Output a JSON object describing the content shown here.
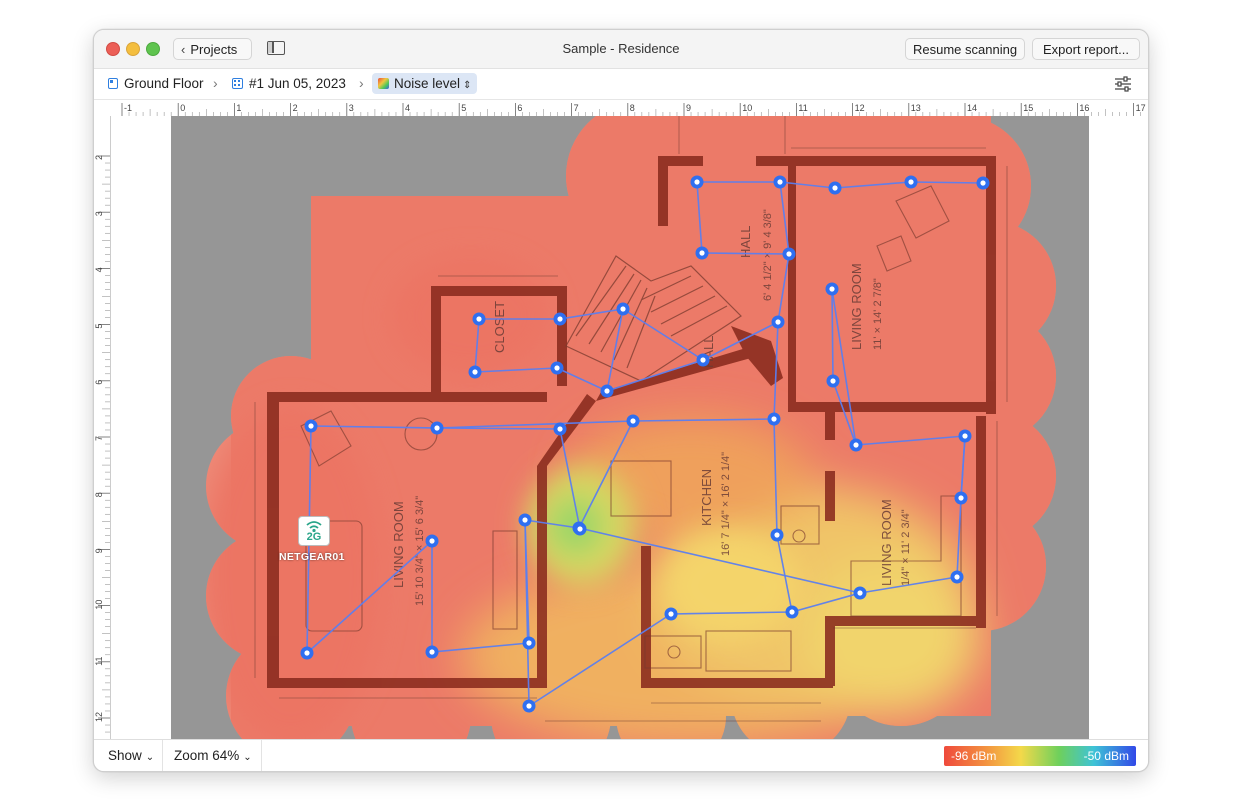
{
  "window": {
    "title": "Sample - Residence",
    "projects_label": "Projects",
    "resume_label": "Resume scanning",
    "export_label": "Export report..."
  },
  "breadcrumb": {
    "floor": "Ground Floor",
    "scan": "#1 Jun 05, 2023",
    "view": "Noise level"
  },
  "ruler": {
    "top_ticks": [
      "-1",
      "0",
      "1",
      "2",
      "3",
      "4",
      "5",
      "6",
      "7",
      "8",
      "9",
      "10",
      "11",
      "12",
      "13",
      "14",
      "15",
      "16",
      "17"
    ],
    "left_ticks": [
      "2",
      "3",
      "4",
      "5",
      "6",
      "7",
      "8",
      "9",
      "10",
      "11",
      "12"
    ]
  },
  "plan": {
    "rooms": [
      {
        "name": "CLOSET"
      },
      {
        "name": "HALL",
        "dims": "6' 4 1/2\" × 9' 4 3/8\""
      },
      {
        "name": "HALL"
      },
      {
        "name": "LIVING ROOM",
        "dims": "11' × 14' 2 7/8\""
      },
      {
        "name": "LIVING ROOM",
        "dims": "15' 10 3/4\" × 15' 6 3/4\""
      },
      {
        "name": "KITCHEN",
        "dims": "16' 7 1/4\" × 16' 2 1/4\""
      },
      {
        "name": "LIVING ROOM",
        "dims": "1/4\" × 11' 2 3/4\""
      }
    ],
    "access_point": {
      "band": "2G",
      "name": "NETGEAR01"
    }
  },
  "bottom": {
    "show_label": "Show",
    "zoom_label": "Zoom 64%",
    "legend_min": "-96 dBm",
    "legend_max": "-50 dBm"
  },
  "colors": {
    "accent": "#2f7fe0",
    "scan_point": "#2f6ff0",
    "wall": "#8a2b1e",
    "noise_high": "#ef4a3c",
    "noise_low": "#3249e8"
  }
}
